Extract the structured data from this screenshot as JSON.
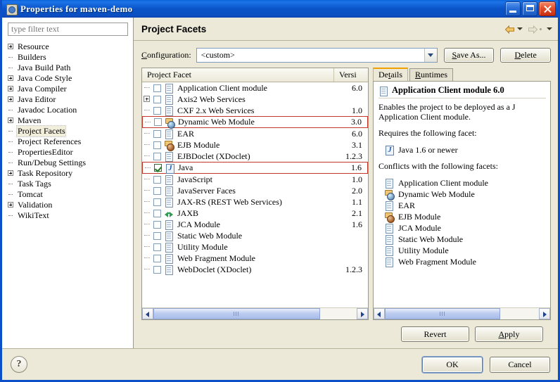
{
  "window": {
    "title": "Properties for maven-demo",
    "icon": "gear-icon",
    "minimize_label": "Minimize",
    "maximize_label": "Maximize",
    "close_label": "Close"
  },
  "sidebar": {
    "filter_placeholder": "type filter text",
    "filter_value": "",
    "items": [
      {
        "label": "Resource",
        "expandable": true,
        "selected": false
      },
      {
        "label": "Builders",
        "expandable": false,
        "selected": false
      },
      {
        "label": "Java Build Path",
        "expandable": false,
        "selected": false
      },
      {
        "label": "Java Code Style",
        "expandable": true,
        "selected": false
      },
      {
        "label": "Java Compiler",
        "expandable": true,
        "selected": false
      },
      {
        "label": "Java Editor",
        "expandable": true,
        "selected": false
      },
      {
        "label": "Javadoc Location",
        "expandable": false,
        "selected": false
      },
      {
        "label": "Maven",
        "expandable": true,
        "selected": false
      },
      {
        "label": "Project Facets",
        "expandable": false,
        "selected": true
      },
      {
        "label": "Project References",
        "expandable": false,
        "selected": false
      },
      {
        "label": "PropertiesEditor",
        "expandable": false,
        "selected": false
      },
      {
        "label": "Run/Debug Settings",
        "expandable": false,
        "selected": false
      },
      {
        "label": "Task Repository",
        "expandable": true,
        "selected": false
      },
      {
        "label": "Task Tags",
        "expandable": false,
        "selected": false
      },
      {
        "label": "Tomcat",
        "expandable": false,
        "selected": false
      },
      {
        "label": "Validation",
        "expandable": true,
        "selected": false
      },
      {
        "label": "WikiText",
        "expandable": false,
        "selected": false
      }
    ]
  },
  "header": {
    "title": "Project Facets",
    "back_tooltip": "Back",
    "forward_tooltip": "Forward",
    "menu_tooltip": "Menu"
  },
  "configuration": {
    "label": "Configuration:",
    "value": "<custom>",
    "save_as_label": "Save As...",
    "delete_label": "Delete"
  },
  "facet_table": {
    "columns": [
      "Project Facet",
      "Versi"
    ],
    "rows": [
      {
        "name": "Application Client module",
        "version": "6.0",
        "checked": false,
        "expandable": false,
        "icon": "document-icon",
        "highlighted": false,
        "selected": true
      },
      {
        "name": "Axis2 Web Services",
        "version": "",
        "checked": false,
        "expandable": true,
        "icon": "document-icon",
        "highlighted": false,
        "selected": false
      },
      {
        "name": "CXF 2.x Web Services",
        "version": "1.0",
        "checked": false,
        "expandable": false,
        "icon": "document-icon",
        "highlighted": false,
        "selected": false
      },
      {
        "name": "Dynamic Web Module",
        "version": "3.0",
        "checked": false,
        "expandable": false,
        "icon": "web-module-icon",
        "highlighted": true,
        "selected": false
      },
      {
        "name": "EAR",
        "version": "6.0",
        "checked": false,
        "expandable": false,
        "icon": "document-icon",
        "highlighted": false,
        "selected": false
      },
      {
        "name": "EJB Module",
        "version": "3.1",
        "checked": false,
        "expandable": false,
        "icon": "ejb-icon",
        "highlighted": false,
        "selected": false
      },
      {
        "name": "EJBDoclet (XDoclet)",
        "version": "1.2.3",
        "checked": false,
        "expandable": false,
        "icon": "document-icon",
        "highlighted": false,
        "selected": false
      },
      {
        "name": "Java",
        "version": "1.6",
        "checked": true,
        "expandable": false,
        "icon": "java-icon",
        "highlighted": true,
        "selected": false
      },
      {
        "name": "JavaScript",
        "version": "1.0",
        "checked": false,
        "expandable": false,
        "icon": "document-icon",
        "highlighted": false,
        "selected": false
      },
      {
        "name": "JavaServer Faces",
        "version": "2.0",
        "checked": false,
        "expandable": false,
        "icon": "document-icon",
        "highlighted": false,
        "selected": false
      },
      {
        "name": "JAX-RS (REST Web Services)",
        "version": "1.1",
        "checked": false,
        "expandable": false,
        "icon": "document-icon",
        "highlighted": false,
        "selected": false
      },
      {
        "name": "JAXB",
        "version": "2.1",
        "checked": false,
        "expandable": false,
        "icon": "jaxb-icon",
        "highlighted": false,
        "selected": false
      },
      {
        "name": "JCA Module",
        "version": "1.6",
        "checked": false,
        "expandable": false,
        "icon": "document-icon",
        "highlighted": false,
        "selected": false
      },
      {
        "name": "Static Web Module",
        "version": "",
        "checked": false,
        "expandable": false,
        "icon": "document-icon",
        "highlighted": false,
        "selected": false
      },
      {
        "name": "Utility Module",
        "version": "",
        "checked": false,
        "expandable": false,
        "icon": "document-icon",
        "highlighted": false,
        "selected": false
      },
      {
        "name": "Web Fragment Module",
        "version": "",
        "checked": false,
        "expandable": false,
        "icon": "document-icon",
        "highlighted": false,
        "selected": false
      },
      {
        "name": "WebDoclet (XDoclet)",
        "version": "1.2.3",
        "checked": false,
        "expandable": false,
        "icon": "document-icon",
        "highlighted": false,
        "selected": false
      }
    ]
  },
  "details_panel": {
    "tabs": [
      {
        "label": "Details",
        "active": true
      },
      {
        "label": "Runtimes",
        "active": false
      }
    ],
    "title": "Application Client module 6.0",
    "title_icon": "document-icon",
    "description": "Enables the project to be deployed as a J Application Client module.",
    "requires_heading": "Requires the following facet:",
    "requires": [
      {
        "label": "Java 1.6 or newer",
        "icon": "java-icon"
      }
    ],
    "conflicts_heading": "Conflicts with the following facets:",
    "conflicts": [
      {
        "label": "Application Client module",
        "icon": "document-icon"
      },
      {
        "label": "Dynamic Web Module",
        "icon": "web-module-icon"
      },
      {
        "label": "EAR",
        "icon": "document-icon"
      },
      {
        "label": "EJB Module",
        "icon": "ejb-icon"
      },
      {
        "label": "JCA Module",
        "icon": "document-icon"
      },
      {
        "label": "Static Web Module",
        "icon": "document-icon"
      },
      {
        "label": "Utility Module",
        "icon": "document-icon"
      },
      {
        "label": "Web Fragment Module",
        "icon": "document-icon"
      }
    ]
  },
  "actions": {
    "revert_label": "Revert",
    "apply_label": "Apply",
    "ok_label": "OK",
    "cancel_label": "Cancel",
    "help_label": "?"
  },
  "colors": {
    "title_bar": "#0a54c8",
    "dialog_bg": "#ece9d8",
    "highlight_border": "#c0392b",
    "active_tab_accent": "#f0a000",
    "checked_mark": "#1f7a1f"
  }
}
